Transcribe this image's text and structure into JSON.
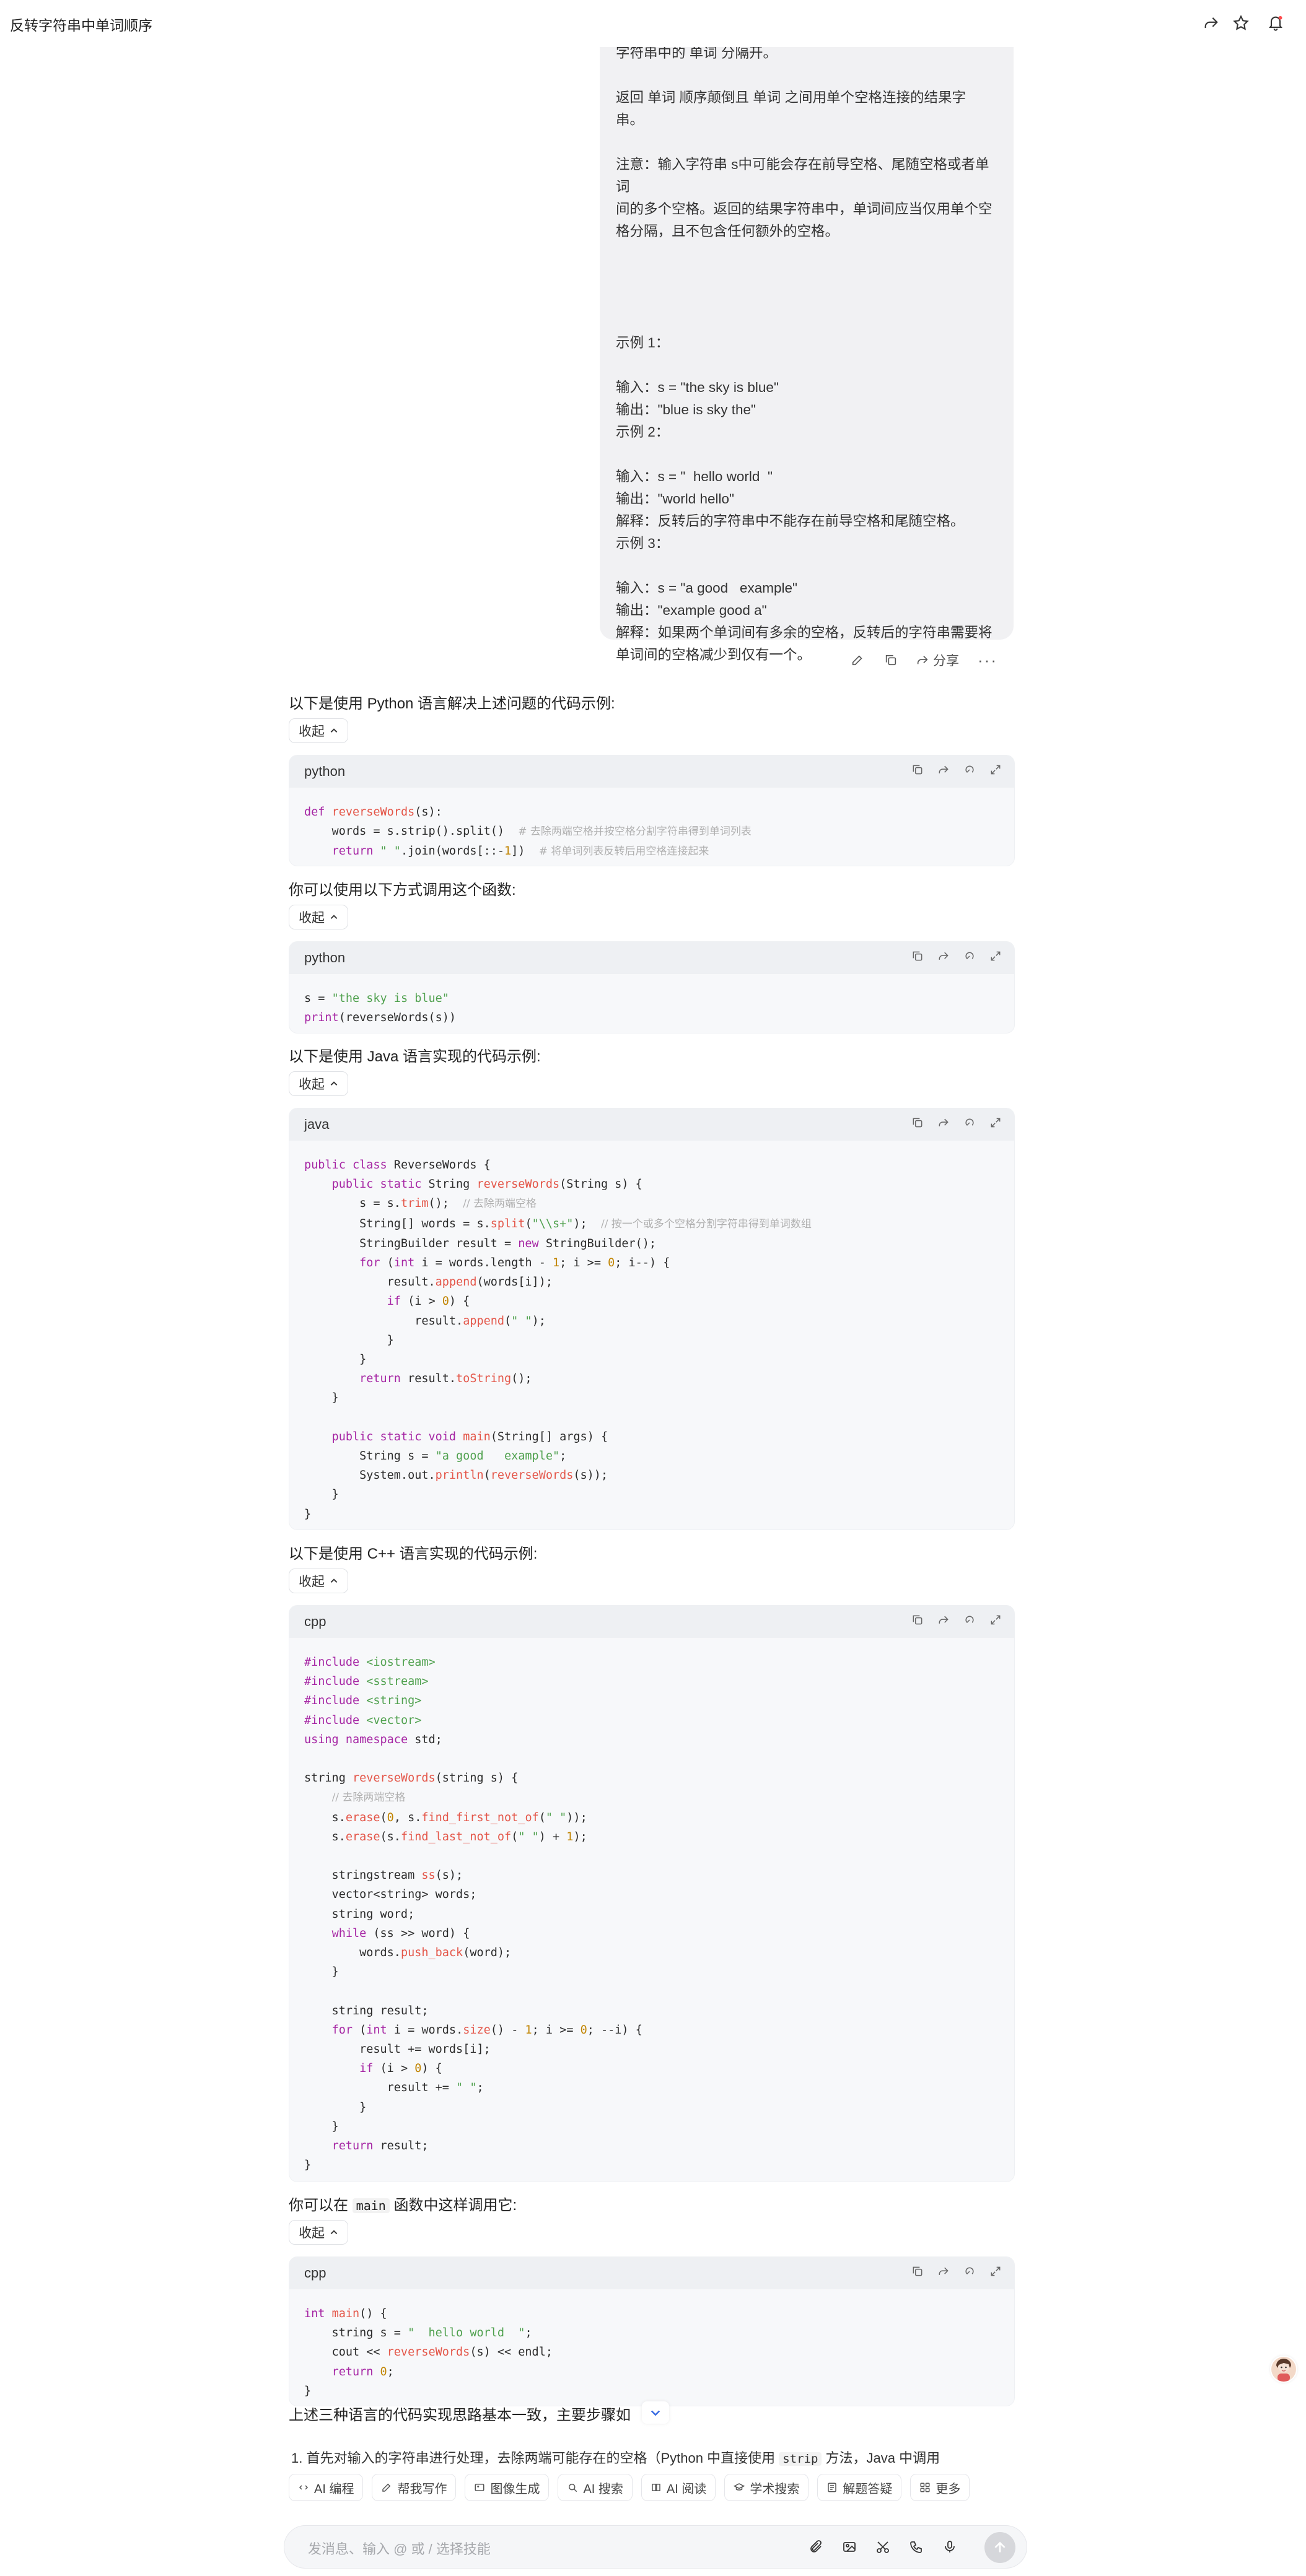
{
  "header": {
    "title": "反转字符串中单词顺序"
  },
  "bubble": {
    "lines": [
      "字符串中的 单词 分隔开。",
      "",
      "返回 单词 顺序颠倒且 单词 之间用单个空格连接的结果字",
      "串。",
      "",
      "注意：输入字符串 s中可能会存在前导空格、尾随空格或者单词",
      "间的多个空格。返回的结果字符串中，单词间应当仅用单个空",
      "格分隔，且不包含任何额外的空格。",
      "",
      "",
      "",
      "",
      "示例 1：",
      "",
      "输入：s = \"the sky is blue\"",
      "输出：\"blue is sky the\"",
      "示例 2：",
      "",
      "输入：s = \"  hello world  \"",
      "输出：\"world hello\"",
      "解释：反转后的字符串中不能存在前导空格和尾随空格。",
      "示例 3：",
      "",
      "输入：s = \"a good   example\"",
      "输出：\"example good a\"",
      "解释：如果两个单词间有多余的空格，反转后的字符串需要将",
      "单词间的空格减少到仅有一个。"
    ],
    "share_label": "分享"
  },
  "reply": {
    "intro_python": "以下是使用 Python 语言解决上述问题的代码示例:",
    "call_python": "你可以使用以下方式调用这个函数:",
    "intro_java": "以下是使用 Java 语言实现的代码示例:",
    "intro_cpp": "以下是使用 C++ 语言实现的代码示例:",
    "call_cpp_pre": "你可以在",
    "call_cpp_code": "main",
    "call_cpp_post": "函数中这样调用它:",
    "collapse_label": "收起",
    "summary": "上述三种语言的代码实现思路基本一致，主要步骤如",
    "step1_pre": "1.  首先对输入的字符串进行处理，去除两端可能存在的空格（Python 中直接使用",
    "step1_code": "strip",
    "step1_post": "方法，Java 中调用"
  },
  "code_blocks": [
    {
      "lang": "python"
    },
    {
      "lang": "python"
    },
    {
      "lang": "java"
    },
    {
      "lang": "cpp"
    },
    {
      "lang": "cpp"
    }
  ],
  "chips": [
    "AI 编程",
    "帮我写作",
    "图像生成",
    "AI 搜索",
    "AI 阅读",
    "学术搜索",
    "解题答疑",
    "更多"
  ],
  "input": {
    "placeholder": "发消息、输入 @ 或 / 选择技能"
  }
}
